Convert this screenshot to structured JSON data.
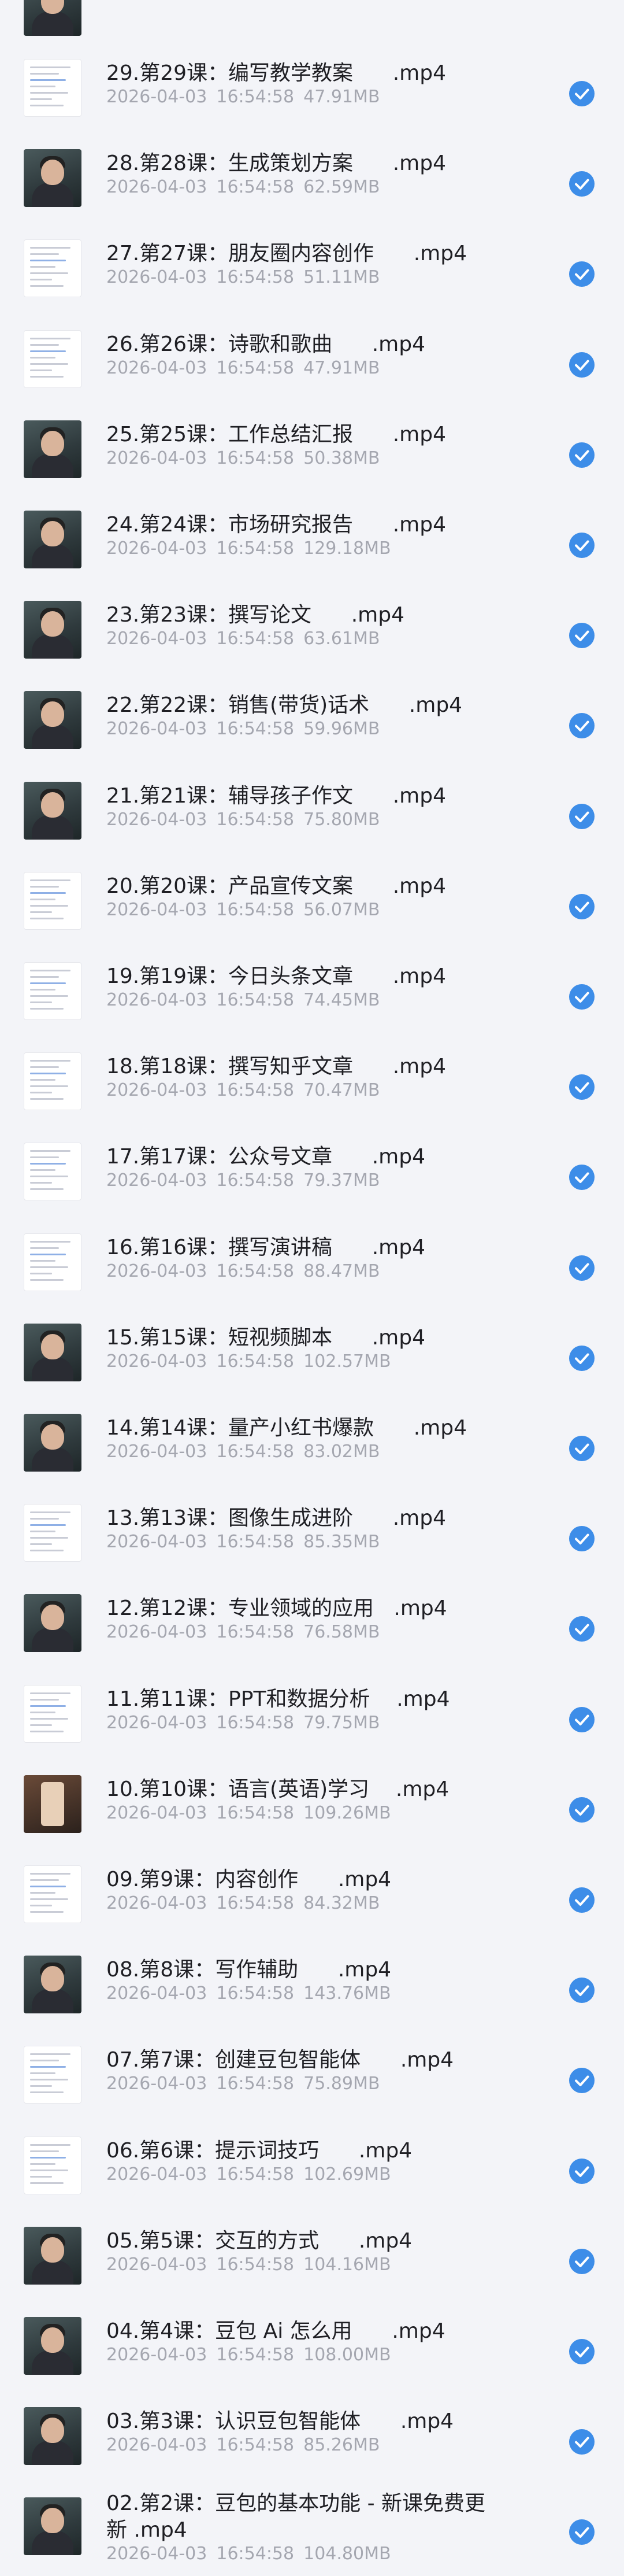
{
  "colors": {
    "check": "#3d8de8",
    "meta": "#a5a7b0",
    "background": "#f3f4f8"
  },
  "icons": {
    "selected": "check-circle-icon"
  },
  "files": [
    {
      "title": "29.第29课：编写教学教案      .mp4",
      "date": "2026-04-03",
      "time": "16:54:58",
      "size": "47.91MB",
      "thumb": "doc"
    },
    {
      "title": "28.第28课：生成策划方案      .mp4",
      "date": "2026-04-03",
      "time": "16:54:58",
      "size": "62.59MB",
      "thumb": "video"
    },
    {
      "title": "27.第27课：朋友圈内容创作      .mp4",
      "date": "2026-04-03",
      "time": "16:54:58",
      "size": "51.11MB",
      "thumb": "doc"
    },
    {
      "title": "26.第26课：诗歌和歌曲      .mp4",
      "date": "2026-04-03",
      "time": "16:54:58",
      "size": "47.91MB",
      "thumb": "doc"
    },
    {
      "title": "25.第25课：工作总结汇报      .mp4",
      "date": "2026-04-03",
      "time": "16:54:58",
      "size": "50.38MB",
      "thumb": "video"
    },
    {
      "title": "24.第24课：市场研究报告      .mp4",
      "date": "2026-04-03",
      "time": "16:54:58",
      "size": "129.18MB",
      "thumb": "video"
    },
    {
      "title": "23.第23课：撰写论文      .mp4",
      "date": "2026-04-03",
      "time": "16:54:58",
      "size": "63.61MB",
      "thumb": "video"
    },
    {
      "title": "22.第22课：销售(带货)话术      .mp4",
      "date": "2026-04-03",
      "time": "16:54:58",
      "size": "59.96MB",
      "thumb": "video"
    },
    {
      "title": "21.第21课：辅导孩子作文      .mp4",
      "date": "2026-04-03",
      "time": "16:54:58",
      "size": "75.80MB",
      "thumb": "video"
    },
    {
      "title": "20.第20课：产品宣传文案      .mp4",
      "date": "2026-04-03",
      "time": "16:54:58",
      "size": "56.07MB",
      "thumb": "doc"
    },
    {
      "title": "19.第19课：今日头条文章      .mp4",
      "date": "2026-04-03",
      "time": "16:54:58",
      "size": "74.45MB",
      "thumb": "doc"
    },
    {
      "title": "18.第18课：撰写知乎文章      .mp4",
      "date": "2026-04-03",
      "time": "16:54:58",
      "size": "70.47MB",
      "thumb": "doc"
    },
    {
      "title": "17.第17课：公众号文章      .mp4",
      "date": "2026-04-03",
      "time": "16:54:58",
      "size": "79.37MB",
      "thumb": "doc"
    },
    {
      "title": "16.第16课：撰写演讲稿      .mp4",
      "date": "2026-04-03",
      "time": "16:54:58",
      "size": "88.47MB",
      "thumb": "doc"
    },
    {
      "title": "15.第15课：短视频脚本      .mp4",
      "date": "2026-04-03",
      "time": "16:54:58",
      "size": "102.57MB",
      "thumb": "video"
    },
    {
      "title": "14.第14课：量产小红书爆款      .mp4",
      "date": "2026-04-03",
      "time": "16:54:58",
      "size": "83.02MB",
      "thumb": "video"
    },
    {
      "title": "13.第13课：图像生成进阶      .mp4",
      "date": "2026-04-03",
      "time": "16:54:58",
      "size": "85.35MB",
      "thumb": "doc"
    },
    {
      "title": "12.第12课：专业领域的应用   .mp4",
      "date": "2026-04-03",
      "time": "16:54:58",
      "size": "76.58MB",
      "thumb": "video"
    },
    {
      "title": "11.第11课：PPT和数据分析    .mp4",
      "date": "2026-04-03",
      "time": "16:54:58",
      "size": "79.75MB",
      "thumb": "doc"
    },
    {
      "title": "10.第10课：语言(英语)学习    .mp4",
      "date": "2026-04-03",
      "time": "16:54:58",
      "size": "109.26MB",
      "thumb": "phone"
    },
    {
      "title": "09.第9课：内容创作      .mp4",
      "date": "2026-04-03",
      "time": "16:54:58",
      "size": "84.32MB",
      "thumb": "doc"
    },
    {
      "title": "08.第8课：写作辅助      .mp4",
      "date": "2026-04-03",
      "time": "16:54:58",
      "size": "143.76MB",
      "thumb": "video"
    },
    {
      "title": "07.第7课：创建豆包智能体      .mp4",
      "date": "2026-04-03",
      "time": "16:54:58",
      "size": "75.89MB",
      "thumb": "doc"
    },
    {
      "title": "06.第6课：提示词技巧      .mp4",
      "date": "2026-04-03",
      "time": "16:54:58",
      "size": "102.69MB",
      "thumb": "doc"
    },
    {
      "title": "05.第5课：交互的方式      .mp4",
      "date": "2026-04-03",
      "time": "16:54:58",
      "size": "104.16MB",
      "thumb": "video"
    },
    {
      "title": "04.第4课：豆包 Ai 怎么用      .mp4",
      "date": "2026-04-03",
      "time": "16:54:58",
      "size": "108.00MB",
      "thumb": "video"
    },
    {
      "title": "03.第3课：认识豆包智能体      .mp4",
      "date": "2026-04-03",
      "time": "16:54:58",
      "size": "85.26MB",
      "thumb": "video"
    },
    {
      "title": "02.第2课：豆包的基本功能 - 新课免费更新 .mp4",
      "date": "2026-04-03",
      "time": "16:54:58",
      "size": "104.80MB",
      "thumb": "video"
    }
  ]
}
